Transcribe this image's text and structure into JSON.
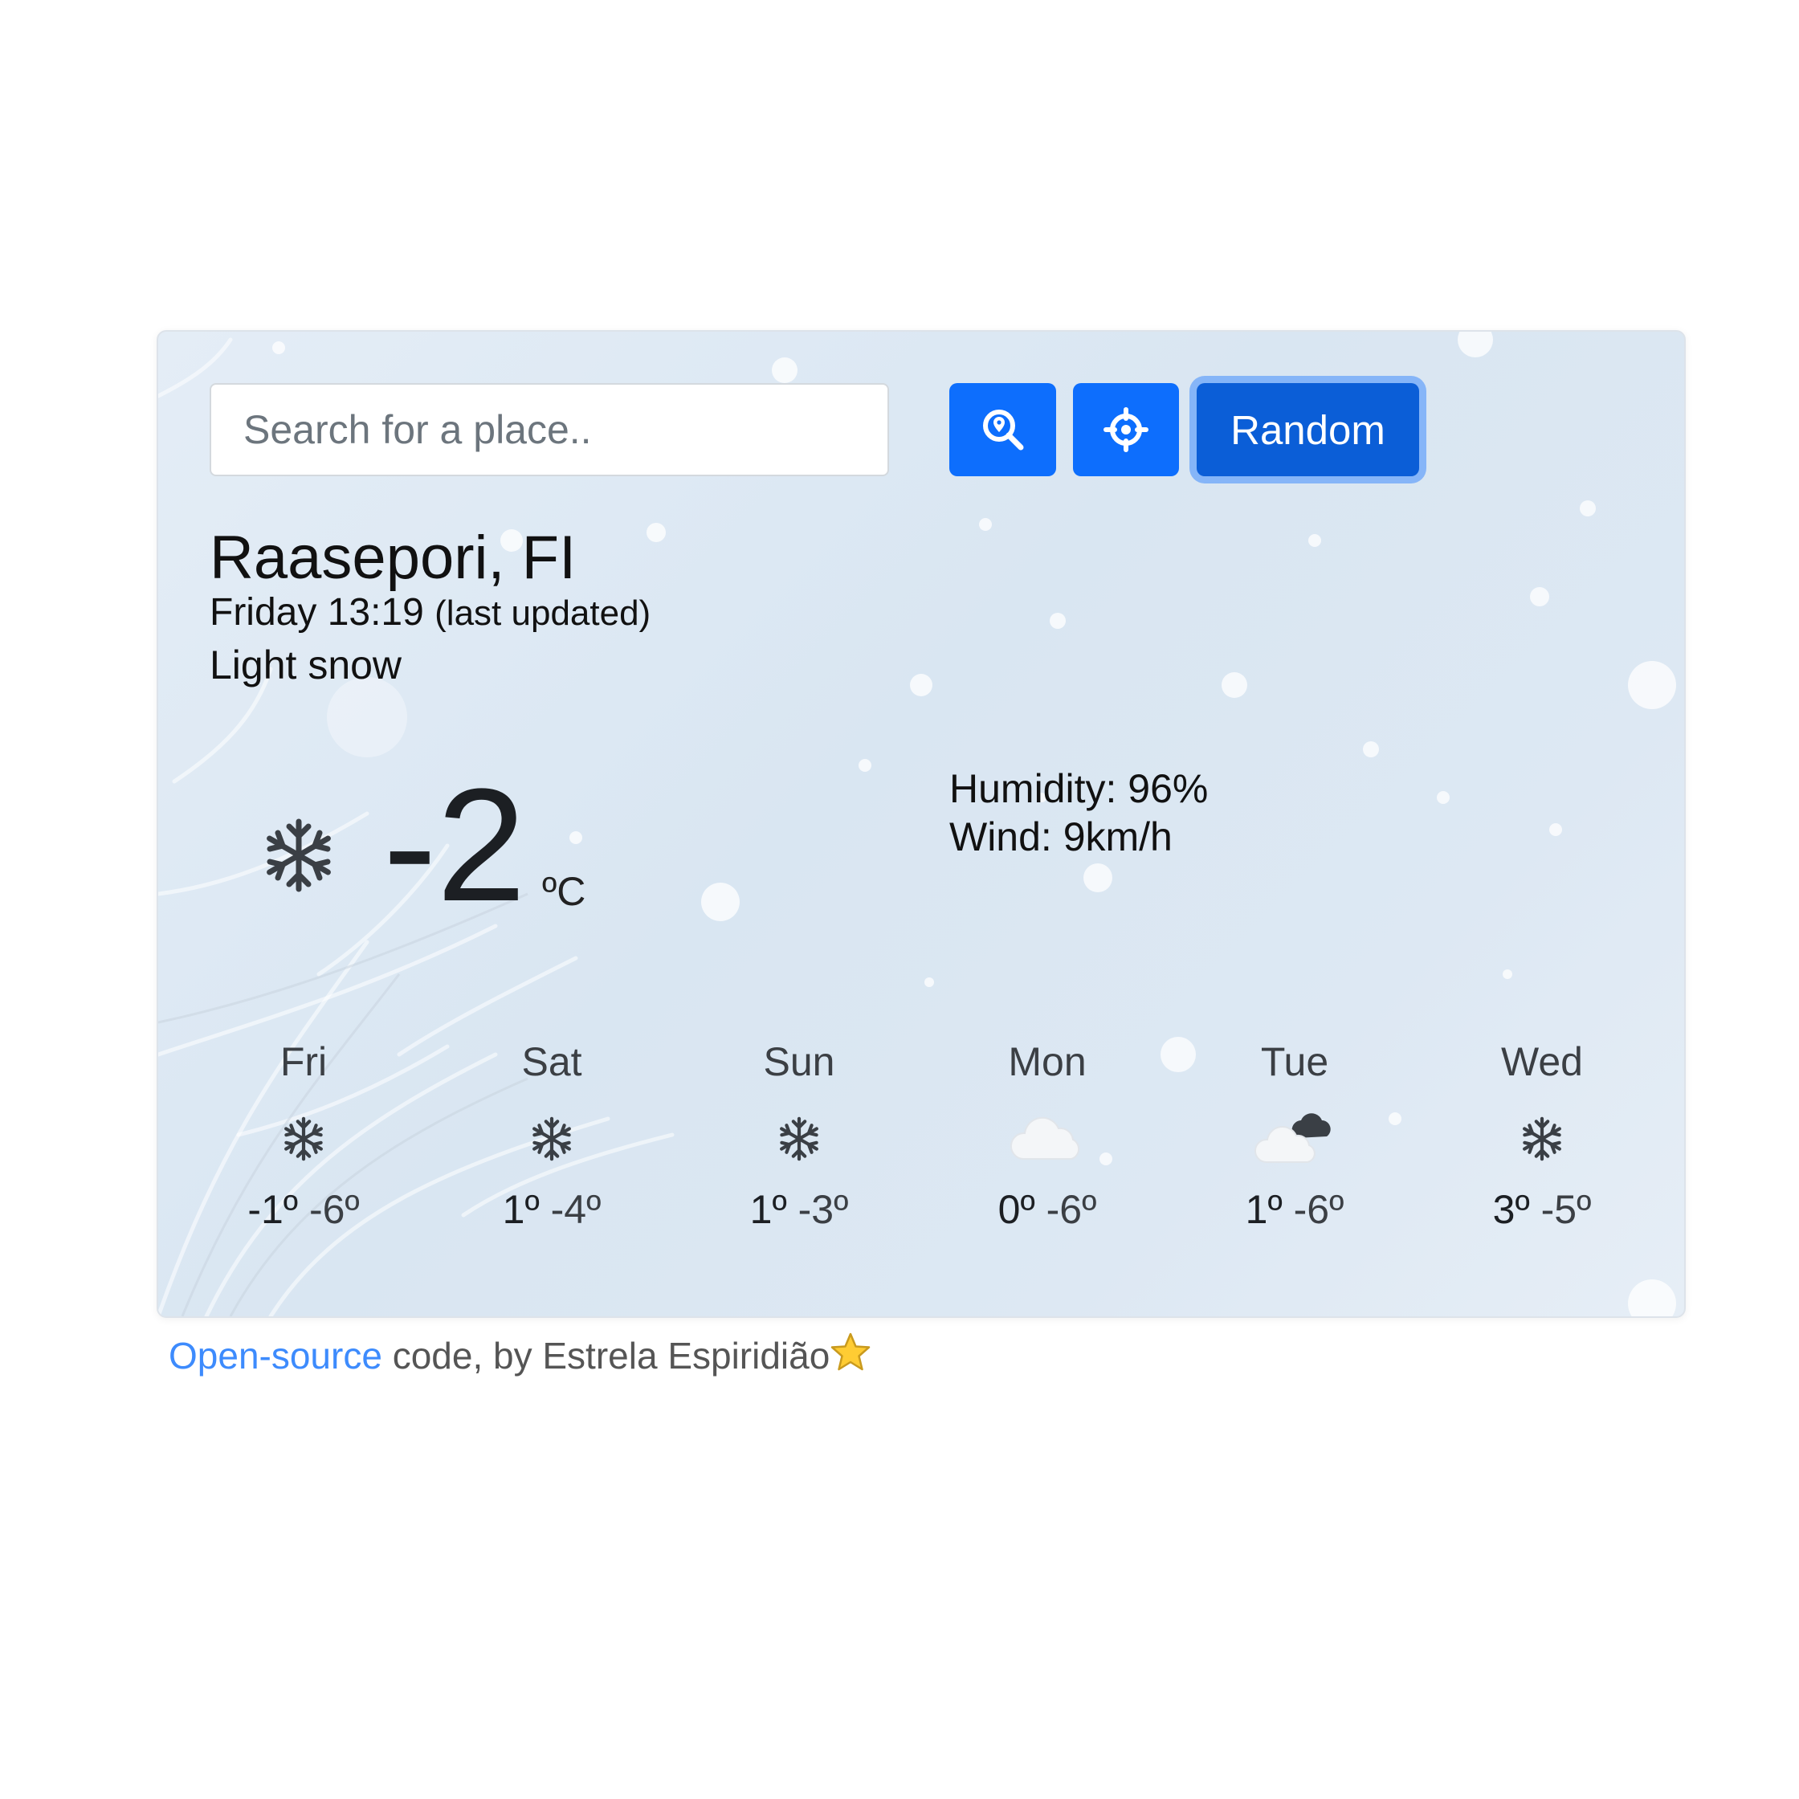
{
  "search": {
    "placeholder": "Search for a place..",
    "value": ""
  },
  "buttons": {
    "search_icon": "search-location-icon",
    "locate_icon": "crosshair-icon",
    "random_label": "Random"
  },
  "current": {
    "city": "Raasepori, FI",
    "day_time": "Friday 13:19",
    "updated_note": "(last updated)",
    "condition": "Light snow",
    "icon": "snowflake-icon",
    "temperature": "-2",
    "unit": "ºC",
    "humidity": "Humidity: 96%",
    "wind": "Wind: 9km/h"
  },
  "forecast": [
    {
      "day": "Fri",
      "icon": "snowflake-icon",
      "high": "-1º",
      "low": "-6º"
    },
    {
      "day": "Sat",
      "icon": "snowflake-icon",
      "high": "1º",
      "low": "-4º"
    },
    {
      "day": "Sun",
      "icon": "snowflake-icon",
      "high": "1º",
      "low": "-3º"
    },
    {
      "day": "Mon",
      "icon": "cloud-icon",
      "high": "0º",
      "low": "-6º"
    },
    {
      "day": "Tue",
      "icon": "cloud-dark-icon",
      "high": "1º",
      "low": "-6º"
    },
    {
      "day": "Wed",
      "icon": "snowflake-icon",
      "high": "3º",
      "low": "-5º"
    }
  ],
  "footer": {
    "link_text": "Open-source",
    "rest_text": " code, by Estrela Espiridião",
    "star_icon": "star-icon"
  },
  "colors": {
    "primary": "#0d6efd",
    "primary_active": "#0b5ed7",
    "link": "#3d8bfd"
  }
}
